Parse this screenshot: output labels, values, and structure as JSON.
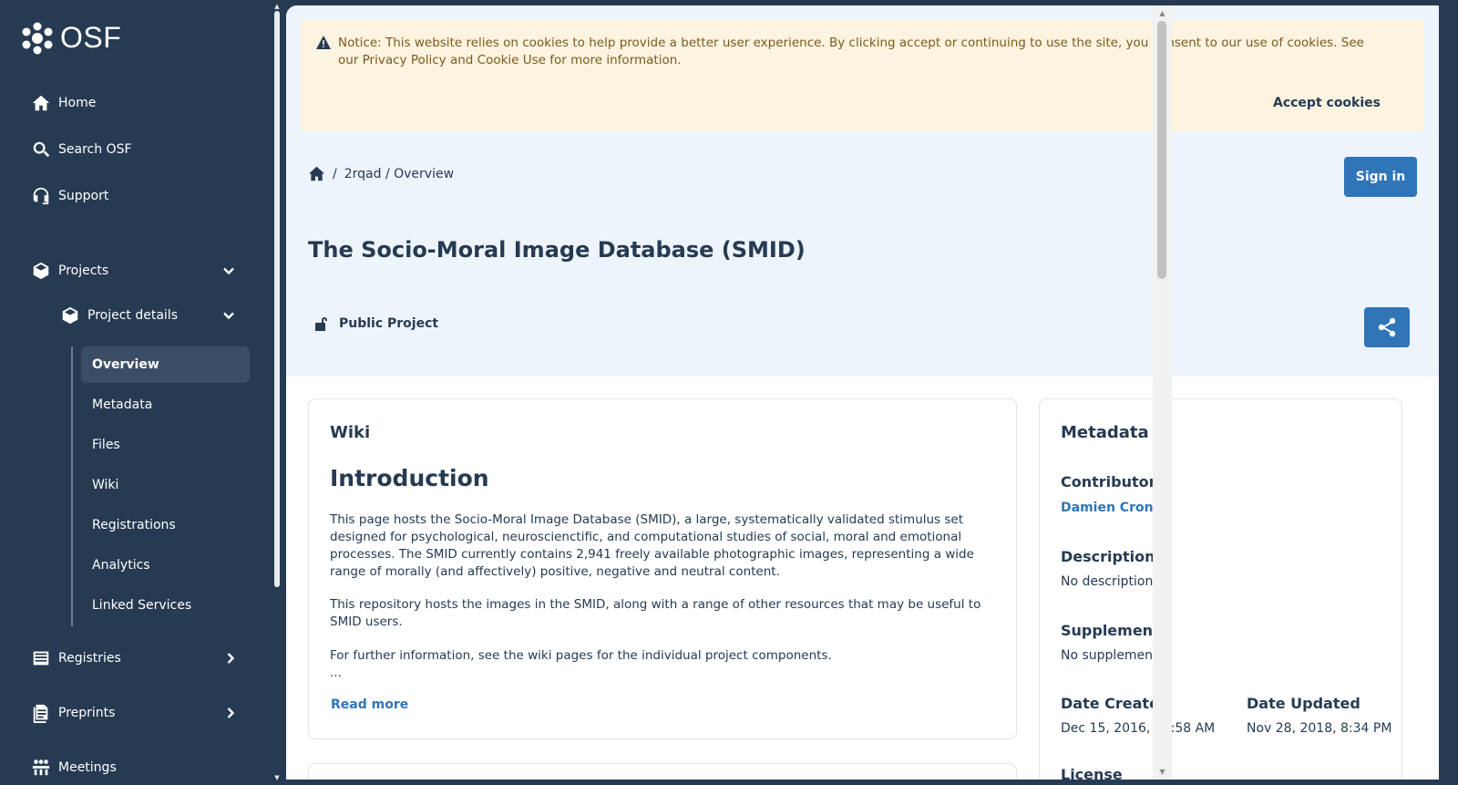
{
  "sidebar": {
    "logo_text": "OSF",
    "nav": {
      "home": "Home",
      "search": "Search OSF",
      "support": "Support",
      "projects": "Projects",
      "project_details": "Project details",
      "registries": "Registries",
      "preprints": "Preprints",
      "meetings": "Meetings"
    },
    "sub_items": [
      "Overview",
      "Metadata",
      "Files",
      "Wiki",
      "Registrations",
      "Analytics",
      "Linked Services"
    ]
  },
  "cookie": {
    "text": "Notice: This website relies on cookies to help provide a better user experience. By clicking accept or continuing to use the site, you consent to our use of cookies. See our Privacy Policy and Cookie Use for more information.",
    "accept_label": "Accept cookies"
  },
  "breadcrumb": {
    "sep": "/",
    "path": "2rqad / Overview"
  },
  "signin_label": "Sign in",
  "project": {
    "title": "The Socio-Moral Image Database (SMID)",
    "visibility": "Public Project"
  },
  "wiki": {
    "heading": "Wiki",
    "intro_title": "Introduction",
    "p1": "This page hosts the Socio-Moral Image Database (SMID), a large, systematically validated stimulus set designed for psychological, neuroscienctific, and computational studies of social, moral and emotional processes. The SMID currently contains 2,941 freely available photographic images, representing a wide range of morally (and affectively) positive, negative and neutral content.",
    "p2": "This repository hosts the images in the SMID, along with a range of other resources that may be useful to SMID users.",
    "p3": "For further information, see the wiki pages for the individual project components.",
    "ellipsis": "...",
    "read_more": "Read more"
  },
  "metadata": {
    "heading": "Metadata",
    "contributors_label": "Contributors",
    "contributor": "Damien Crone",
    "description_label": "Description",
    "description": "No description",
    "supplements_label": "Supplements",
    "supplements": "No supplements",
    "date_created_label": "Date Created",
    "date_created": "Dec 15, 2016, 11:58 AM",
    "date_updated_label": "Date Updated",
    "date_updated": "Nov 28, 2018, 8:34 PM",
    "license_label": "License"
  },
  "colors": {
    "sidebar_bg": "#263a52",
    "accent": "#2f75b8",
    "notice_bg": "#fcf3e0",
    "header_bg": "#eef4fb"
  }
}
